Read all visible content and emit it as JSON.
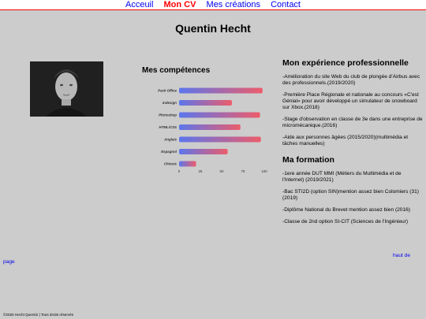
{
  "nav": {
    "items": [
      {
        "label": "Acceuil"
      },
      {
        "label": "Mon CV"
      },
      {
        "label": "Mes créations"
      },
      {
        "label": "Contact"
      }
    ]
  },
  "header": {
    "name": "Quentin Hecht"
  },
  "photo": {
    "icon": "person-portrait"
  },
  "skills": {
    "title": "Mes compétences"
  },
  "chart_data": {
    "type": "bar",
    "orientation": "horizontal",
    "categories": [
      "Pack Office",
      "Indesign",
      "Photoshop",
      "HTML/CSS",
      "Anglais",
      "Espagnol",
      "Chinois"
    ],
    "values": [
      98,
      62,
      95,
      72,
      96,
      57,
      20
    ],
    "xlim": [
      0,
      100
    ],
    "xticks": [
      0,
      25,
      50,
      75,
      100
    ],
    "colors": {
      "start": "#4f6cf0",
      "end": "#f05060"
    }
  },
  "experience": {
    "title": "Mon expérience professionnelle",
    "items": [
      "-Amélioration du site Web du club de plongée d'Airbus avec des professionnels.(2019/2020)",
      "-Première Place Régionale et nationale au concours «C'est Génial» pour avoir développé un simulateur de snowboard sur Xbox.(2018)",
      "-Stage d'observation en classe de 3e dans une entreprise de micromécanique.(2016)",
      "-Aide aux personnes âgées (2015/2020)(multimédia et tâches manuelles)"
    ]
  },
  "formation": {
    "title": "Ma formation",
    "items": [
      "-1ere année DUT MMI (Métiers du Multimédia et de l'Internet) (2019/2021)",
      "-Bac STI2D (option SIN)mention assez bien Colomiers (31)(2019)",
      "-Diplôme National du Brevet mention assez bien (2016)",
      "-Classe de 2nd option SI-CIT (Sciences de l'Ingénieur)"
    ]
  },
  "links": {
    "top_a": "haut de",
    "top_b": "page"
  },
  "footer": {
    "text": "©2020 Hecht Quentin | Tous droits réservés"
  }
}
